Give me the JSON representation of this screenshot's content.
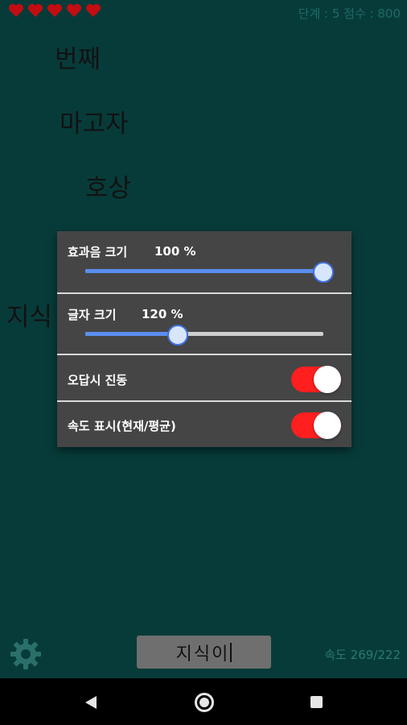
{
  "status": {
    "lives": 5,
    "stage_score": "단계 : 5 점수 : 800"
  },
  "falling_words": [
    "번째",
    "마고자",
    "호상",
    "지식"
  ],
  "settings": {
    "sfx_label": "효과음 크기",
    "sfx_value": "100 %",
    "sfx_level": 1.0,
    "font_label": "글자 크기",
    "font_value": "120 %",
    "font_level": 0.39,
    "vibrate_label": "오답시 진동",
    "vibrate_on": true,
    "speed_label": "속도 표시(현재/평균)",
    "speed_on": true
  },
  "input": {
    "value": "지식이"
  },
  "speed_text": "속도 269/222",
  "colors": {
    "background": "#073b39",
    "accent": "#5b8ef0",
    "toggle_on": "#ff1f1f",
    "heart": "#c20d12"
  }
}
